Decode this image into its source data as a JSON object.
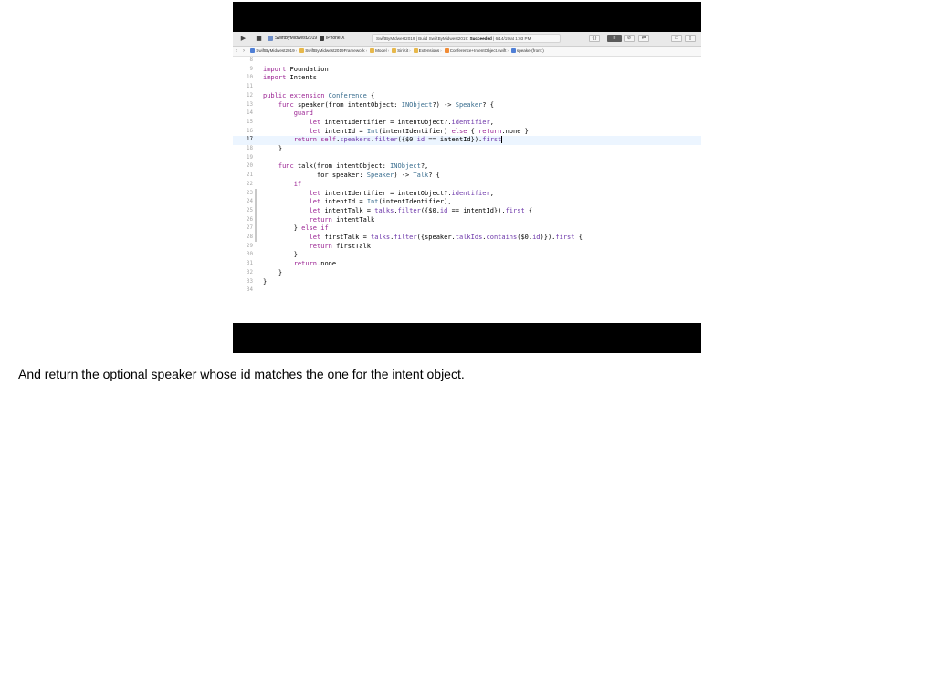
{
  "toolbar": {
    "run_icon": "play-icon",
    "stop_icon": "stop-icon",
    "scheme": "SwiftByMidwest2019",
    "destination": "iPhone X",
    "activity_prefix": "SwiftByMidwest2019 | Build SwiftByMidwest2019:",
    "activity_status": "Succeeded",
    "activity_time": "| 6/14/19 at 1:03 PM",
    "right_buttons": [
      "{ }",
      "≡",
      "⊘",
      "⇄",
      "▭",
      "▯"
    ]
  },
  "jumpbar": {
    "back": "‹",
    "forward": "›",
    "crumbs": [
      {
        "label": "SwiftByMidwest2019",
        "color": "#4f7fd6"
      },
      {
        "label": "SwiftByMidwest2019Framework",
        "color": "#e7b84b"
      },
      {
        "label": "Model",
        "color": "#e7b84b"
      },
      {
        "label": "SiriKit",
        "color": "#e7b84b"
      },
      {
        "label": "Extensions",
        "color": "#e7b84b"
      },
      {
        "label": "Conference+IntentObject.swift",
        "color": "#f08b35"
      },
      {
        "label": "speaker(from:)",
        "color": "#4f7fd6"
      }
    ]
  },
  "colors": {
    "keyword": "#9b2393",
    "type": "#3a6e8f",
    "property": "#6c36a9",
    "current_line": "#ecf5ff"
  },
  "code": {
    "current_line": "17",
    "lines": [
      {
        "n": "8",
        "parts": []
      },
      {
        "n": "9",
        "parts": [
          [
            "kw",
            "import"
          ],
          [
            "",
            "Foundation"
          ]
        ]
      },
      {
        "n": "10",
        "parts": [
          [
            "kw",
            "import"
          ],
          [
            "",
            "Intents"
          ]
        ]
      },
      {
        "n": "11",
        "parts": []
      },
      {
        "n": "12",
        "parts": [
          [
            "kw",
            "public extension"
          ],
          [
            "ty",
            "Conference"
          ],
          [
            "",
            "{"
          ]
        ]
      },
      {
        "n": "13",
        "parts": [
          [
            "",
            "    "
          ],
          [
            "kw",
            "func"
          ],
          [
            "",
            "speaker(from intentObject:"
          ],
          [
            "ty",
            "INObject"
          ],
          [
            "",
            "?) ->"
          ],
          [
            "ty",
            "Speaker"
          ],
          [
            "",
            "? {"
          ]
        ]
      },
      {
        "n": "14",
        "parts": [
          [
            "",
            "        "
          ],
          [
            "kw",
            "guard"
          ]
        ]
      },
      {
        "n": "15",
        "parts": [
          [
            "",
            "            "
          ],
          [
            "kw",
            "let"
          ],
          [
            "",
            "intentIdentifier = intentObject?."
          ],
          [
            "pr",
            "identifier"
          ],
          [
            "",
            ","
          ]
        ]
      },
      {
        "n": "16",
        "parts": [
          [
            "",
            "            "
          ],
          [
            "kw",
            "let"
          ],
          [
            "",
            "intentId ="
          ],
          [
            "ty",
            "Int"
          ],
          [
            "",
            "(intentIdentifier)"
          ],
          [
            "kw",
            "else"
          ],
          [
            "",
            "{"
          ],
          [
            "kw",
            "return"
          ],
          [
            "",
            ".none }"
          ]
        ]
      },
      {
        "n": "17",
        "parts": [
          [
            "",
            "        "
          ],
          [
            "kw",
            "return self"
          ],
          [
            "",
            "."
          ],
          [
            "pr",
            "speakers"
          ],
          [
            "",
            "."
          ],
          [
            "pr",
            "filter"
          ],
          [
            "",
            "({$0."
          ],
          [
            "pr",
            "id"
          ],
          [
            "",
            "== intentId})."
          ],
          [
            "pr",
            "first"
          ]
        ]
      },
      {
        "n": "18",
        "parts": [
          [
            "",
            "    }"
          ]
        ]
      },
      {
        "n": "19",
        "parts": []
      },
      {
        "n": "20",
        "parts": [
          [
            "",
            "    "
          ],
          [
            "kw",
            "func"
          ],
          [
            "",
            "talk(from intentObject:"
          ],
          [
            "ty",
            "INObject"
          ],
          [
            "",
            "?,"
          ]
        ]
      },
      {
        "n": "21",
        "parts": [
          [
            "",
            "              for speaker:"
          ],
          [
            "ty",
            "Speaker"
          ],
          [
            "",
            ") ->"
          ],
          [
            "ty",
            "Talk"
          ],
          [
            "",
            "? {"
          ]
        ]
      },
      {
        "n": "22",
        "parts": [
          [
            "",
            "        "
          ],
          [
            "kw",
            "if"
          ]
        ]
      },
      {
        "n": "23",
        "parts": [
          [
            "",
            "            "
          ],
          [
            "kw",
            "let"
          ],
          [
            "",
            "intentIdentifier = intentObject?."
          ],
          [
            "pr",
            "identifier"
          ],
          [
            "",
            ","
          ]
        ]
      },
      {
        "n": "24",
        "parts": [
          [
            "",
            "            "
          ],
          [
            "kw",
            "let"
          ],
          [
            "",
            "intentId ="
          ],
          [
            "ty",
            "Int"
          ],
          [
            "",
            "(intentIdentifier),"
          ]
        ]
      },
      {
        "n": "25",
        "parts": [
          [
            "",
            "            "
          ],
          [
            "kw",
            "let"
          ],
          [
            "",
            "intentTalk ="
          ],
          [
            "pr",
            "talks"
          ],
          [
            "",
            "."
          ],
          [
            "pr",
            "filter"
          ],
          [
            "",
            "({$0."
          ],
          [
            "pr",
            "id"
          ],
          [
            "",
            "== intentId})."
          ],
          [
            "pr",
            "first"
          ],
          [
            "",
            "{"
          ]
        ]
      },
      {
        "n": "26",
        "parts": [
          [
            "",
            "            "
          ],
          [
            "kw",
            "return"
          ],
          [
            "",
            "intentTalk"
          ]
        ]
      },
      {
        "n": "27",
        "parts": [
          [
            "",
            "        }"
          ],
          [
            "kw",
            "else if"
          ]
        ]
      },
      {
        "n": "28",
        "parts": [
          [
            "",
            "            "
          ],
          [
            "kw",
            "let"
          ],
          [
            "",
            "firstTalk ="
          ],
          [
            "pr",
            "talks"
          ],
          [
            "",
            "."
          ],
          [
            "pr",
            "filter"
          ],
          [
            "",
            "({speaker."
          ],
          [
            "pr",
            "talkIds"
          ],
          [
            "",
            "."
          ],
          [
            "pr",
            "contains"
          ],
          [
            "",
            "($0."
          ],
          [
            "pr",
            "id"
          ],
          [
            "",
            ")})."
          ],
          [
            "pr",
            "first"
          ],
          [
            "",
            "{"
          ]
        ]
      },
      {
        "n": "29",
        "parts": [
          [
            "",
            "            "
          ],
          [
            "kw",
            "return"
          ],
          [
            "",
            "firstTalk"
          ]
        ]
      },
      {
        "n": "30",
        "parts": [
          [
            "",
            "        }"
          ]
        ]
      },
      {
        "n": "31",
        "parts": [
          [
            "",
            "        "
          ],
          [
            "kw",
            "return"
          ],
          [
            "",
            ".none"
          ]
        ]
      },
      {
        "n": "32",
        "parts": [
          [
            "",
            "    }"
          ]
        ]
      },
      {
        "n": "33",
        "parts": [
          [
            "",
            "}"
          ]
        ]
      },
      {
        "n": "34",
        "parts": []
      }
    ]
  },
  "caption": "And return the optional speaker whose id matches the one for the intent object."
}
